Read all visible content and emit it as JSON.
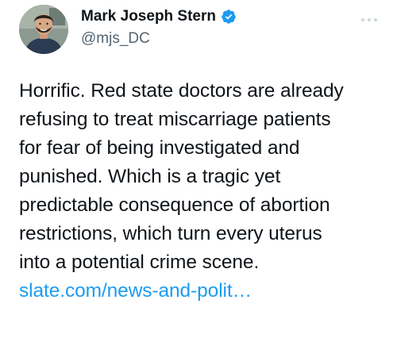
{
  "author": {
    "display_name": "Mark Joseph Stern",
    "handle": "@mjs_DC",
    "verified": true
  },
  "tweet": {
    "lines": [
      "Horrific. Red state doctors are already",
      "refusing to treat miscarriage patients",
      "for fear of being investigated and",
      "punished. Which is a tragic yet",
      "predictable consequence of abortion",
      "restrictions, which turn every uterus",
      "into a potential crime scene."
    ],
    "link_text": "slate.com/news-and-polit…"
  },
  "icons": {
    "verified": "verified-badge-icon",
    "more": "more-options-icon"
  },
  "colors": {
    "link": "#1d9bf0",
    "verified_badge": "#1d9bf0",
    "handle": "#536471",
    "text": "#0f1419",
    "more_icon": "#cfd9de"
  }
}
